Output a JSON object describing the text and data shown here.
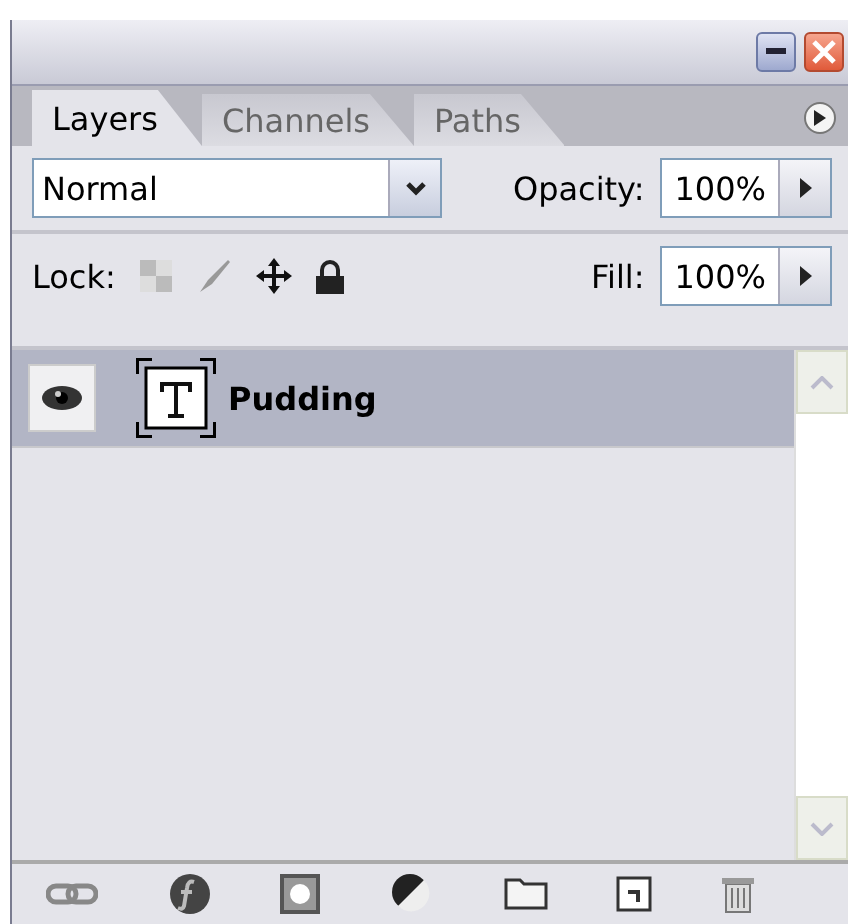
{
  "tabs": [
    {
      "label": "Layers",
      "selected": true
    },
    {
      "label": "Channels",
      "selected": false
    },
    {
      "label": "Paths",
      "selected": false
    }
  ],
  "blend_mode": {
    "value": "Normal"
  },
  "opacity": {
    "label": "Opacity:",
    "value": "100%"
  },
  "lock": {
    "label": "Lock:"
  },
  "fill": {
    "label": "Fill:",
    "value": "100%"
  },
  "layers": [
    {
      "name": "Pudding",
      "kind": "text",
      "visible": true,
      "selected": true
    }
  ]
}
